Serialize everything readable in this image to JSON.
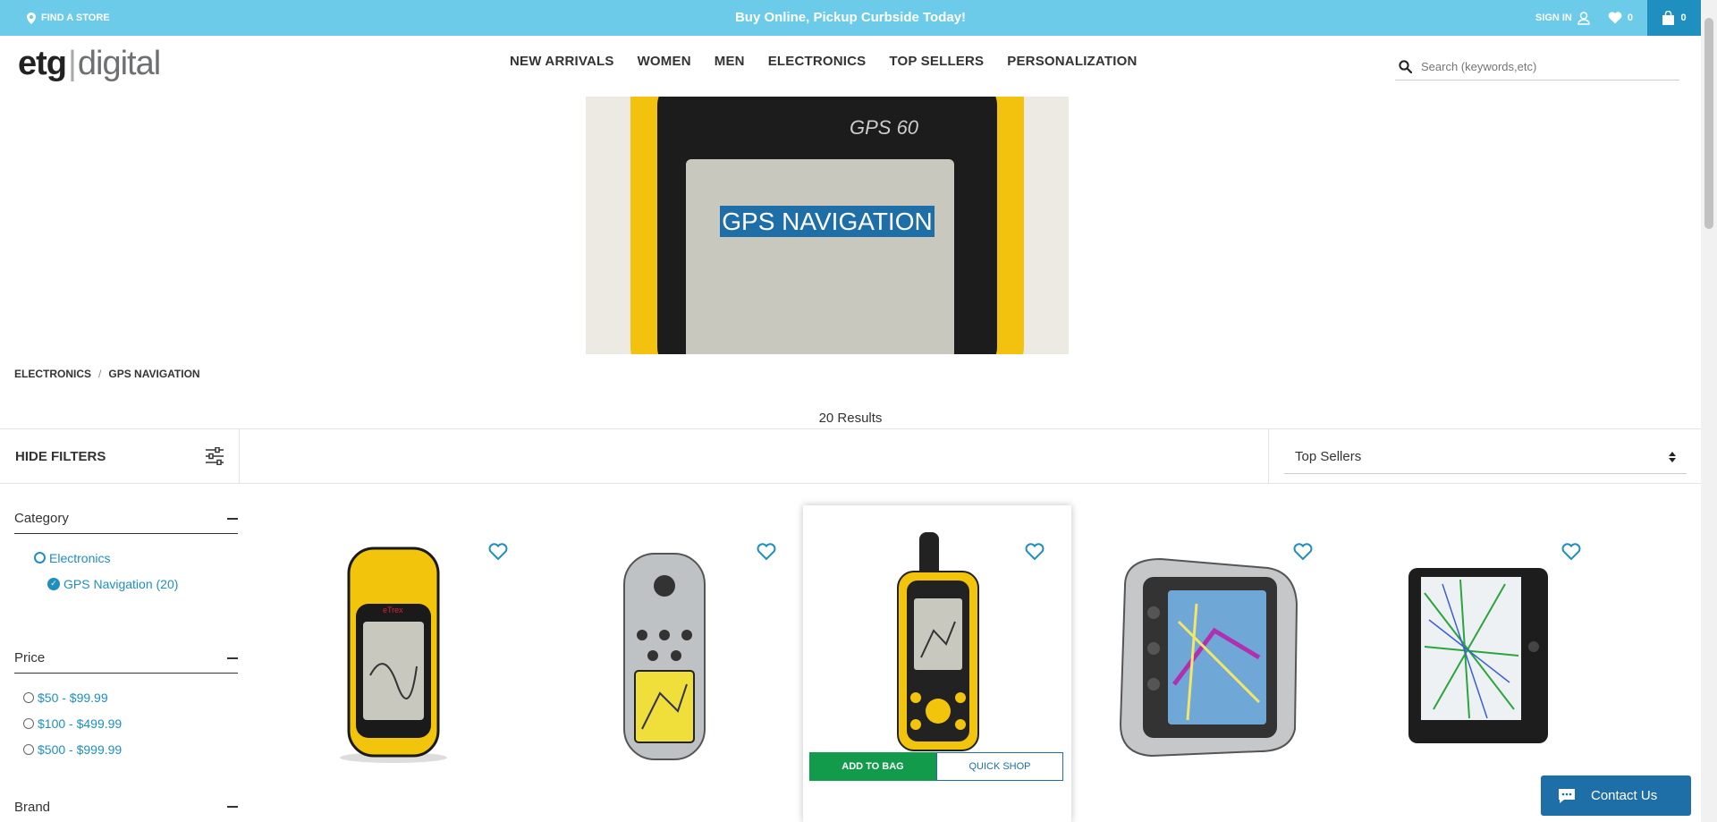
{
  "topbar": {
    "find_store": "FIND A STORE",
    "promo": "Buy Online, Pickup Curbside Today!",
    "signin": "SIGN IN",
    "wishlist_count": "0",
    "bag_count": "0",
    "bg_color": "#6ccbe9"
  },
  "header": {
    "logo_etg": "etg",
    "logo_digital": "digital",
    "nav": [
      "NEW ARRIVALS",
      "WOMEN",
      "MEN",
      "ELECTRONICS",
      "TOP SELLERS",
      "PERSONALIZATION"
    ],
    "search_placeholder": "Search (keywords,etc)"
  },
  "hero": {
    "title": "GPS NAVIGATION",
    "screen_text": "GPS 60"
  },
  "breadcrumb": [
    "ELECTRONICS",
    "GPS NAVIGATION"
  ],
  "results": "20 Results",
  "filters": {
    "hide_label": "HIDE FILTERS",
    "sort_value": "Top Sellers"
  },
  "facets": {
    "category": {
      "title": "Category",
      "options": [
        "Electronics",
        "GPS Navigation (20)"
      ]
    },
    "price": {
      "title": "Price",
      "options": [
        "$50 - $99.99",
        "$100 - $499.99",
        "$500 - $999.99"
      ]
    },
    "brand": {
      "title": "Brand"
    }
  },
  "products": [
    {
      "device": "handheld-yellow"
    },
    {
      "device": "handheld-silver"
    },
    {
      "device": "handheld-antenna"
    },
    {
      "device": "car-silver"
    },
    {
      "device": "tablet-black"
    }
  ],
  "product_actions": {
    "add_to_bag": "ADD TO BAG",
    "quick_shop": "QUICK SHOP"
  },
  "contact": "Contact Us",
  "colors": {
    "accent": "#1e8fbf",
    "add_button": "#129b4a",
    "contact_button": "#1e6ea7"
  }
}
